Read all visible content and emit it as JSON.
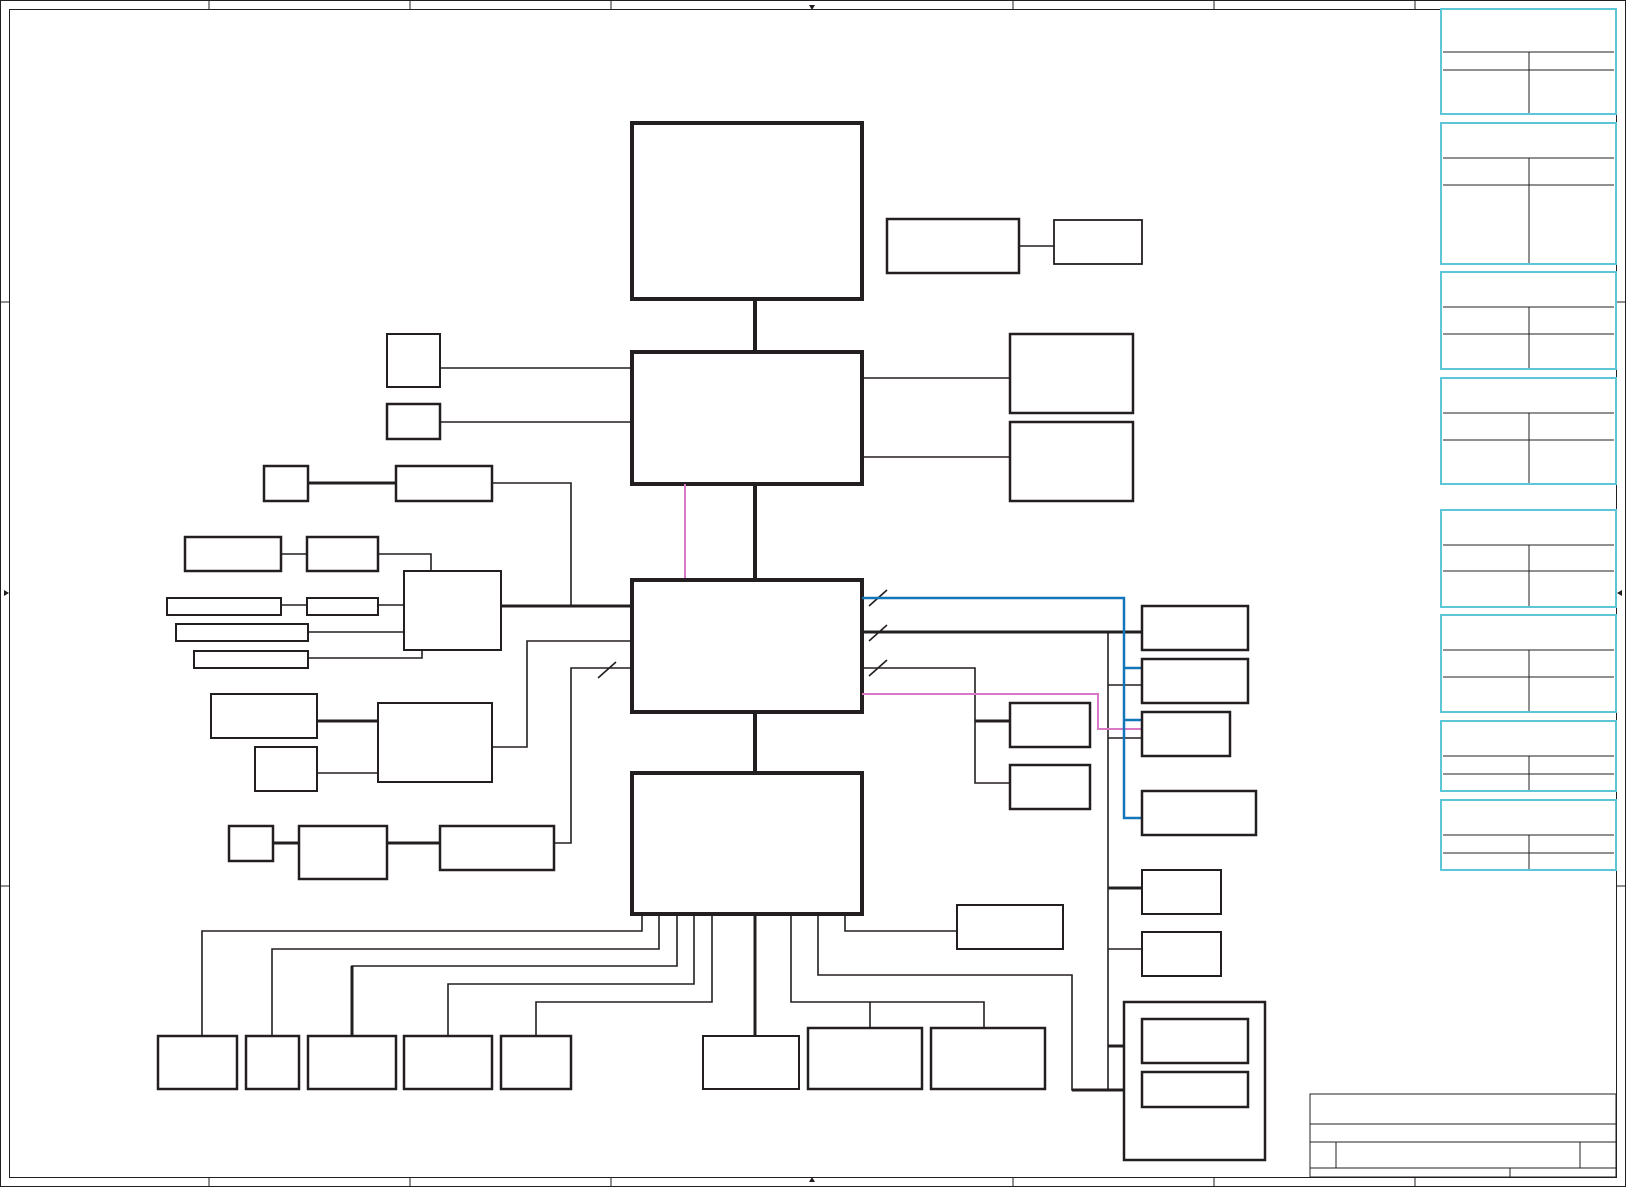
{
  "sheet": {
    "title": "",
    "colors": {
      "line": "#231f20",
      "accent_cyan": "#5cc6d6",
      "accent_blue": "#1276b8",
      "accent_pink": "#d978c4",
      "background": "#ffffff"
    }
  },
  "blocks": [
    {
      "id": "cpu",
      "label": ""
    },
    {
      "id": "north-bridge",
      "label": ""
    },
    {
      "id": "south-bridge",
      "label": ""
    },
    {
      "id": "super-io",
      "label": ""
    },
    {
      "id": "clock-gen",
      "label": ""
    },
    {
      "id": "clock-buffer",
      "label": ""
    },
    {
      "id": "dimm-a",
      "label": ""
    },
    {
      "id": "dimm-b",
      "label": ""
    },
    {
      "id": "video-connector",
      "label": ""
    },
    {
      "id": "video-port",
      "label": ""
    },
    {
      "id": "lan-rj45",
      "label": ""
    },
    {
      "id": "lan-controller",
      "label": ""
    },
    {
      "id": "audio-codec",
      "label": ""
    },
    {
      "id": "audio-jack-1",
      "label": ""
    },
    {
      "id": "audio-jack-2",
      "label": ""
    },
    {
      "id": "audio-jack-3",
      "label": ""
    },
    {
      "id": "audio-jack-4",
      "label": ""
    },
    {
      "id": "pcie-controller",
      "label": ""
    },
    {
      "id": "pcie-slot-a",
      "label": ""
    },
    {
      "id": "pcie-slot-b",
      "label": ""
    },
    {
      "id": "usb-port",
      "label": ""
    },
    {
      "id": "usb-hub",
      "label": ""
    },
    {
      "id": "usb-controller",
      "label": ""
    },
    {
      "id": "usb-device-1",
      "label": ""
    },
    {
      "id": "usb-device-2",
      "label": ""
    },
    {
      "id": "usb-device-3",
      "label": ""
    },
    {
      "id": "usb-device-4",
      "label": ""
    },
    {
      "id": "sata-port-1",
      "label": ""
    },
    {
      "id": "sata-port-2",
      "label": ""
    },
    {
      "id": "expansion-device-1",
      "label": ""
    },
    {
      "id": "expansion-device-2",
      "label": ""
    },
    {
      "id": "spi-flash",
      "label": ""
    },
    {
      "id": "fan-controller",
      "label": ""
    },
    {
      "id": "tpm",
      "label": ""
    },
    {
      "id": "sensor",
      "label": ""
    },
    {
      "id": "battery",
      "label": ""
    },
    {
      "id": "keyboard-controller",
      "label": ""
    },
    {
      "id": "touchpad",
      "label": ""
    },
    {
      "id": "ec-rom",
      "label": ""
    },
    {
      "id": "debug-port",
      "label": ""
    },
    {
      "id": "lpc-device",
      "label": ""
    },
    {
      "id": "card-reader",
      "label": ""
    },
    {
      "id": "docking-port",
      "label": ""
    },
    {
      "id": "power-module",
      "label": ""
    },
    {
      "id": "power-sub-1",
      "label": ""
    },
    {
      "id": "power-sub-2",
      "label": ""
    }
  ],
  "side_tables": [
    {
      "id": "table-1",
      "rows": []
    },
    {
      "id": "table-2",
      "rows": []
    },
    {
      "id": "table-3",
      "rows": []
    },
    {
      "id": "table-4",
      "rows": []
    },
    {
      "id": "table-5",
      "rows": []
    },
    {
      "id": "table-6",
      "rows": []
    },
    {
      "id": "table-7",
      "rows": []
    },
    {
      "id": "table-8",
      "rows": []
    }
  ],
  "title_block": {
    "title": "",
    "sheet": "",
    "rev": ""
  }
}
